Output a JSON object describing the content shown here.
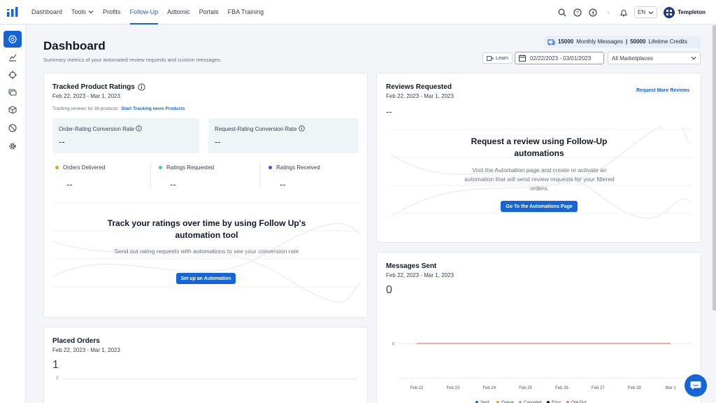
{
  "nav": {
    "items": [
      {
        "label": "Dashboard",
        "active": false,
        "caret": false
      },
      {
        "label": "Tools",
        "active": false,
        "caret": true
      },
      {
        "label": "Profits",
        "active": false,
        "caret": false
      },
      {
        "label": "Follow-Up",
        "active": true,
        "caret": false
      },
      {
        "label": "Adtomic",
        "active": false,
        "caret": false
      },
      {
        "label": "Portals",
        "active": false,
        "caret": false
      },
      {
        "label": "FBA Training",
        "active": false,
        "caret": false
      }
    ],
    "language": "EN",
    "user_name": "Templeton"
  },
  "sidebar": {
    "icons": [
      "dashboard-gauge-icon",
      "chart-icon",
      "target-icon",
      "messages-icon",
      "box-icon",
      "block-icon",
      "gear-icon"
    ]
  },
  "header": {
    "title": "Dashboard",
    "subtitle": "Summary metrics of your automated review requests and custom messages.",
    "monthly_messages_value": "15000",
    "monthly_messages_label": "Monthly Messages",
    "separator": "|",
    "lifetime_credits_value": "50000",
    "lifetime_credits_label": "Lifetime Credits",
    "learn_label": "Learn",
    "date_range": "02/22/2023 - 03/01/2023",
    "marketplace": "All Marketplaces"
  },
  "tracked": {
    "title": "Tracked Product Ratings",
    "date": "Feb 22, 2023 - Mar 1, 2023",
    "tracking_text": "Tracking reviews for 38 products",
    "tracking_link": "Start Tracking more Products",
    "order_rating_label": "Order-Rating Conversion Rate",
    "order_rating_value": "--",
    "request_rating_label": "Request-Rating Conversion Rate",
    "request_rating_value": "--",
    "stats": [
      {
        "label": "Orders Delivered",
        "value": "--",
        "color": "#f59e0b"
      },
      {
        "label": "Ratings Requested",
        "value": "--",
        "color": "#34d399"
      },
      {
        "label": "Ratings Received",
        "value": "--",
        "color": "#4f46e5"
      }
    ],
    "empty_title": "Track your ratings over time by using Follow Up's automation tool",
    "empty_text": "Send out rating requests with automations to see your conversion rate",
    "cta_label": "Set up an Automation"
  },
  "reviews": {
    "title": "Reviews Requested",
    "date": "Feb 22, 2023 - Mar 1, 2023",
    "link": "Request More Reviews",
    "value": "--",
    "empty_title": "Request a review using Follow-Up automations",
    "empty_text": "Visit the Automation page and create or activate an automation that will send review requests for your filtered orders.",
    "cta_label": "Go To the Automations Page"
  },
  "placed": {
    "title": "Placed Orders",
    "date": "Feb 22, 2023 - Mar 1, 2023",
    "value": "1",
    "y_tick": "2"
  },
  "messages": {
    "title": "Messages Sent",
    "date": "Feb 22, 2023 - Mar 1, 2023",
    "value": "0",
    "legend": [
      {
        "label": "Sent",
        "color": "#1565d8"
      },
      {
        "label": "Queue",
        "color": "#f59e0b"
      },
      {
        "label": "Canceled",
        "color": "#9ca3af"
      },
      {
        "label": "Error",
        "color": "#111827"
      },
      {
        "label": "Opt-Out",
        "color": "#f87171"
      }
    ]
  },
  "chart_data": {
    "type": "line",
    "title": "Messages Sent",
    "categories": [
      "Feb 22",
      "Feb 23",
      "Feb 24",
      "Feb 25",
      "Feb 26",
      "Feb 27",
      "Feb 28",
      "Mar 1"
    ],
    "y_ticks": [
      "0"
    ],
    "series": [
      {
        "name": "Opt-Out",
        "values": [
          0,
          0,
          0,
          0,
          0,
          0,
          0,
          0
        ],
        "color": "#f87171"
      }
    ],
    "legend_placement": "bottom",
    "grid": true
  }
}
